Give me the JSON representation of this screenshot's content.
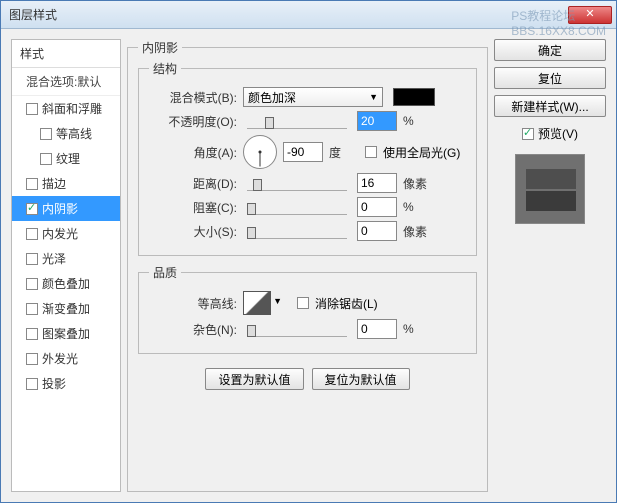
{
  "window": {
    "title": "图层样式"
  },
  "watermark": {
    "l1": "PS教程论坛",
    "l2": "BBS.16XX8.COM"
  },
  "left": {
    "header": "样式",
    "sub": "混合选项:默认",
    "items": [
      {
        "label": "斜面和浮雕",
        "checked": false
      },
      {
        "label": "等高线",
        "checked": false,
        "indent": true
      },
      {
        "label": "纹理",
        "checked": false,
        "indent": true
      },
      {
        "label": "描边",
        "checked": false
      },
      {
        "label": "内阴影",
        "checked": true,
        "selected": true
      },
      {
        "label": "内发光",
        "checked": false
      },
      {
        "label": "光泽",
        "checked": false
      },
      {
        "label": "颜色叠加",
        "checked": false
      },
      {
        "label": "渐变叠加",
        "checked": false
      },
      {
        "label": "图案叠加",
        "checked": false
      },
      {
        "label": "外发光",
        "checked": false
      },
      {
        "label": "投影",
        "checked": false
      }
    ]
  },
  "center": {
    "outer_legend": "内阴影",
    "struct_legend": "结构",
    "quality_legend": "品质",
    "blend_label": "混合模式(B):",
    "blend_value": "颜色加深",
    "opacity_label": "不透明度(O):",
    "opacity_value": "20",
    "opacity_unit": "%",
    "angle_label": "角度(A):",
    "angle_value": "-90",
    "angle_unit": "度",
    "global_label": "使用全局光(G)",
    "distance_label": "距离(D):",
    "distance_value": "16",
    "distance_unit": "像素",
    "choke_label": "阻塞(C):",
    "choke_value": "0",
    "choke_unit": "%",
    "size_label": "大小(S):",
    "size_value": "0",
    "size_unit": "像素",
    "contour_label": "等高线:",
    "antialias_label": "消除锯齿(L)",
    "noise_label": "杂色(N):",
    "noise_value": "0",
    "noise_unit": "%",
    "btn_default": "设置为默认值",
    "btn_reset": "复位为默认值"
  },
  "right": {
    "ok": "确定",
    "cancel": "复位",
    "newstyle": "新建样式(W)...",
    "preview_label": "预览(V)"
  }
}
